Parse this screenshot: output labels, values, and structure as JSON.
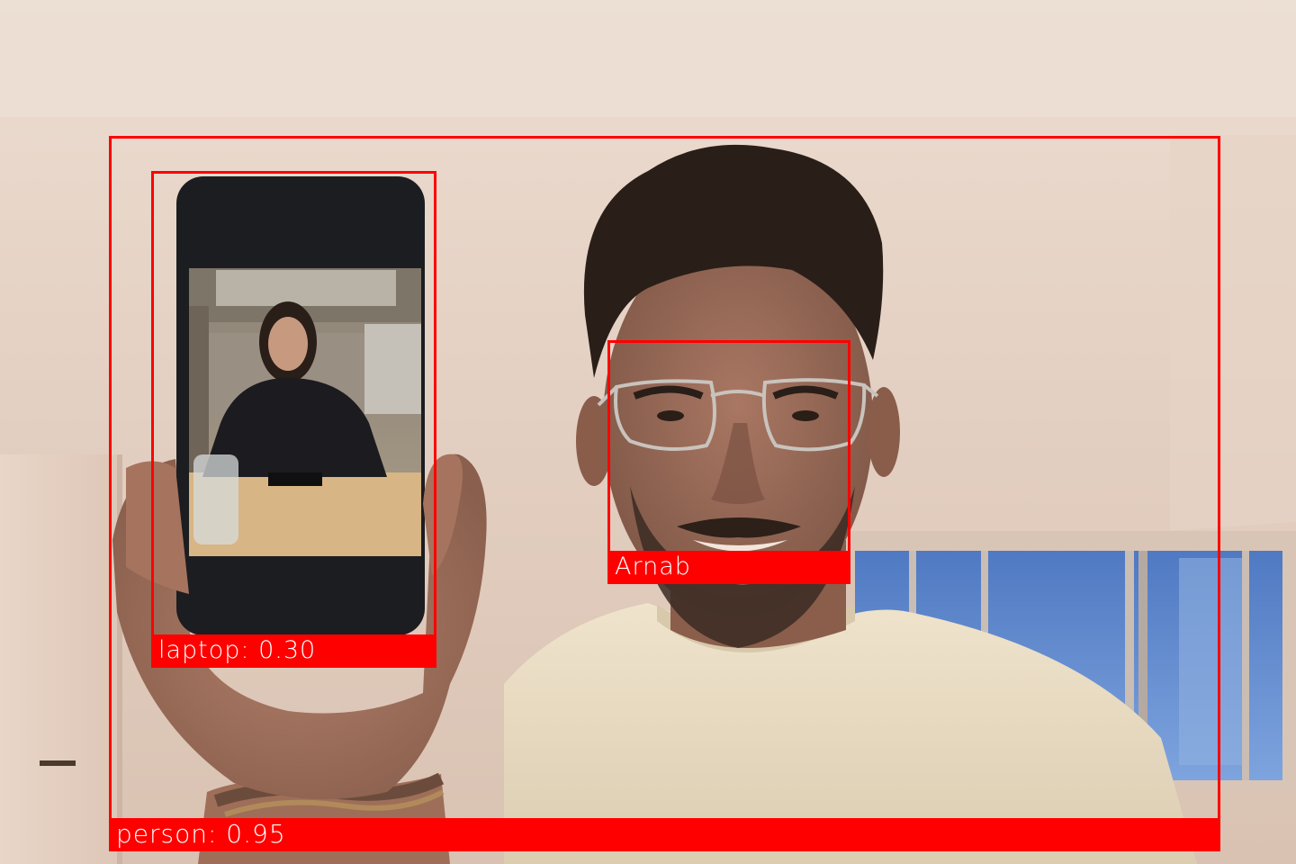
{
  "image": {
    "description_colors": {
      "wall": "#e2ccbd",
      "ceiling": "#ead8cb",
      "window_glass": "#5b82c6",
      "shirt": "#e9dcc3",
      "skin": "#9a6a55",
      "hair": "#2a1e18",
      "phone_body": "#1c1d20",
      "detection_red": "#ff0000",
      "label_text": "#ffffff"
    }
  },
  "detections": [
    {
      "id": "person",
      "label": "person: 0.95"
    },
    {
      "id": "laptop",
      "label": "laptop: 0.30"
    },
    {
      "id": "face",
      "label": "Arnab"
    }
  ]
}
